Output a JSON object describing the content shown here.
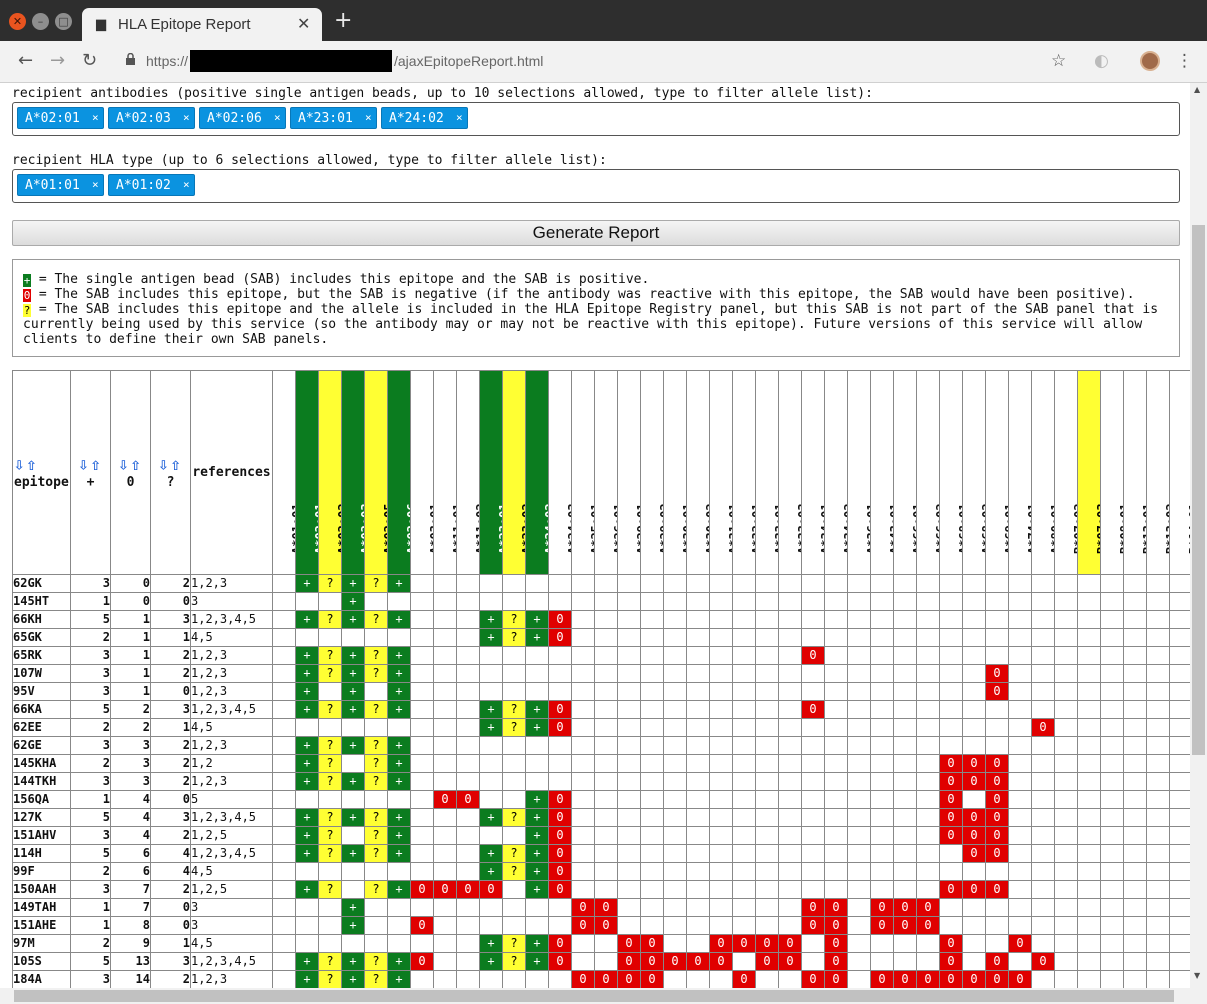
{
  "browser": {
    "tab_title": "HLA Epitope Report",
    "url_prefix": "https://",
    "url_suffix": "/ajaxEpitopeReport.html",
    "new_tab": "+"
  },
  "form": {
    "antibodies_label": "recipient antibodies (positive single antigen beads, up to 10 selections allowed, type to filter allele list):",
    "antibodies": [
      "A*02:01",
      "A*02:03",
      "A*02:06",
      "A*23:01",
      "A*24:02"
    ],
    "hla_label": "recipient HLA type (up to 6 selections allowed, type to filter allele list):",
    "hla_types": [
      "A*01:01",
      "A*01:02"
    ],
    "chip_remove": "×",
    "generate_button": "Generate Report"
  },
  "legend": {
    "plus_symbol": "+",
    "zero_symbol": "0",
    "question_symbol": "?",
    "plus_text": " = The single antigen bead (SAB) includes this epitope and the SAB is positive.",
    "zero_text": " = The SAB includes this epitope, but the SAB is negative (if the antibody was reactive with this epitope, the SAB would have been positive).",
    "question_text": " = The SAB includes this epitope and the allele is included in the HLA Epitope Registry panel, but this SAB is not part of the SAB panel that is",
    "question_text_cont": "currently being used by this service (so the antibody may or may not be reactive with this epitope). Future versions of this service will allow",
    "question_text_cont2": "clients to define their own SAB panels."
  },
  "table": {
    "sort_arrows": "⇩⇧",
    "headers": {
      "epitope": "epitope",
      "plus": "+",
      "zero": "0",
      "question": "?",
      "references": "references"
    },
    "alleles": [
      "A*01:01",
      "A*02:01",
      "A*02:02",
      "A*02:03",
      "A*02:05",
      "A*02:06",
      "A*03:01",
      "A*11:01",
      "A*11:02",
      "A*23:01",
      "A*23:02",
      "A*24:02",
      "A*24:03",
      "A*25:01",
      "A*26:01",
      "A*29:01",
      "A*29:02",
      "A*30:01",
      "A*30:02",
      "A*31:01",
      "A*32:01",
      "A*33:01",
      "A*33:03",
      "A*34:01",
      "A*34:02",
      "A*36:01",
      "A*43:01",
      "A*66:01",
      "A*66:02",
      "A*68:01",
      "A*68:02",
      "A*69:01",
      "A*74:01",
      "A*80:01",
      "B*07:02",
      "B*07:03",
      "B*08:01",
      "B*13:01",
      "B*13:02",
      "B*14:01"
    ],
    "header_colors": [
      "",
      "g",
      "y",
      "g",
      "y",
      "g",
      "",
      "",
      "",
      "g",
      "y",
      "g",
      "",
      "",
      "",
      "",
      "",
      "",
      "",
      "",
      "",
      "",
      "",
      "",
      "",
      "",
      "",
      "",
      "",
      "",
      "",
      "",
      "",
      "",
      "",
      "y",
      "",
      "",
      "",
      ""
    ],
    "rows": [
      {
        "epitope": "62GK",
        "plus": "3",
        "zero": "0",
        "q": "2",
        "refs": "1,2,3",
        "cells": {
          "1": "+",
          "2": "?",
          "3": "+",
          "4": "?",
          "5": "+"
        }
      },
      {
        "epitope": "145HT",
        "plus": "1",
        "zero": "0",
        "q": "0",
        "refs": "3",
        "cells": {
          "3": "+"
        }
      },
      {
        "epitope": "66KH",
        "plus": "5",
        "zero": "1",
        "q": "3",
        "refs": "1,2,3,4,5",
        "cells": {
          "1": "+",
          "2": "?",
          "3": "+",
          "4": "?",
          "5": "+",
          "9": "+",
          "10": "?",
          "11": "+",
          "12": "0"
        }
      },
      {
        "epitope": "65GK",
        "plus": "2",
        "zero": "1",
        "q": "1",
        "refs": "4,5",
        "cells": {
          "9": "+",
          "10": "?",
          "11": "+",
          "12": "0"
        }
      },
      {
        "epitope": "65RK",
        "plus": "3",
        "zero": "1",
        "q": "2",
        "refs": "1,2,3",
        "cells": {
          "1": "+",
          "2": "?",
          "3": "+",
          "4": "?",
          "5": "+",
          "23": "0"
        }
      },
      {
        "epitope": "107W",
        "plus": "3",
        "zero": "1",
        "q": "2",
        "refs": "1,2,3",
        "cells": {
          "1": "+",
          "2": "?",
          "3": "+",
          "4": "?",
          "5": "+",
          "31": "0"
        }
      },
      {
        "epitope": "95V",
        "plus": "3",
        "zero": "1",
        "q": "0",
        "refs": "1,2,3",
        "cells": {
          "1": "+",
          "3": "+",
          "5": "+",
          "31": "0"
        }
      },
      {
        "epitope": "66KA",
        "plus": "5",
        "zero": "2",
        "q": "3",
        "refs": "1,2,3,4,5",
        "cells": {
          "1": "+",
          "2": "?",
          "3": "+",
          "4": "?",
          "5": "+",
          "9": "+",
          "10": "?",
          "11": "+",
          "12": "0",
          "23": "0"
        }
      },
      {
        "epitope": "62EE",
        "plus": "2",
        "zero": "2",
        "q": "1",
        "refs": "4,5",
        "cells": {
          "9": "+",
          "10": "?",
          "11": "+",
          "12": "0",
          "33": "0"
        }
      },
      {
        "epitope": "62GE",
        "plus": "3",
        "zero": "3",
        "q": "2",
        "refs": "1,2,3",
        "cells": {
          "1": "+",
          "2": "?",
          "3": "+",
          "4": "?",
          "5": "+"
        }
      },
      {
        "epitope": "145KHA",
        "plus": "2",
        "zero": "3",
        "q": "2",
        "refs": "1,2",
        "cells": {
          "1": "+",
          "2": "?",
          "4": "?",
          "5": "+",
          "29": "0",
          "30": "0",
          "31": "0"
        }
      },
      {
        "epitope": "144TKH",
        "plus": "3",
        "zero": "3",
        "q": "2",
        "refs": "1,2,3",
        "cells": {
          "1": "+",
          "2": "?",
          "3": "+",
          "4": "?",
          "5": "+",
          "29": "0",
          "30": "0",
          "31": "0"
        }
      },
      {
        "epitope": "156QA",
        "plus": "1",
        "zero": "4",
        "q": "0",
        "refs": "5",
        "cells": {
          "7": "0",
          "8": "0",
          "11": "+",
          "12": "0",
          "29": "0",
          "31": "0"
        }
      },
      {
        "epitope": "127K",
        "plus": "5",
        "zero": "4",
        "q": "3",
        "refs": "1,2,3,4,5",
        "cells": {
          "1": "+",
          "2": "?",
          "3": "+",
          "4": "?",
          "5": "+",
          "9": "+",
          "10": "?",
          "11": "+",
          "12": "0",
          "29": "0",
          "30": "0",
          "31": "0"
        }
      },
      {
        "epitope": "151AHV",
        "plus": "3",
        "zero": "4",
        "q": "2",
        "refs": "1,2,5",
        "cells": {
          "1": "+",
          "2": "?",
          "4": "?",
          "5": "+",
          "11": "+",
          "12": "0",
          "29": "0",
          "30": "0",
          "31": "0"
        }
      },
      {
        "epitope": "114H",
        "plus": "5",
        "zero": "6",
        "q": "4",
        "refs": "1,2,3,4,5",
        "cells": {
          "1": "+",
          "2": "?",
          "3": "+",
          "4": "?",
          "5": "+",
          "9": "+",
          "10": "?",
          "11": "+",
          "12": "0",
          "30": "0",
          "31": "0"
        }
      },
      {
        "epitope": "99F",
        "plus": "2",
        "zero": "6",
        "q": "4",
        "refs": "4,5",
        "cells": {
          "9": "+",
          "10": "?",
          "11": "+",
          "12": "0"
        }
      },
      {
        "epitope": "150AAH",
        "plus": "3",
        "zero": "7",
        "q": "2",
        "refs": "1,2,5",
        "cells": {
          "1": "+",
          "2": "?",
          "4": "?",
          "5": "+",
          "6": "0",
          "7": "0",
          "8": "0",
          "9": "0",
          "11": "+",
          "12": "0",
          "29": "0",
          "30": "0",
          "31": "0"
        }
      },
      {
        "epitope": "149TAH",
        "plus": "1",
        "zero": "7",
        "q": "0",
        "refs": "3",
        "cells": {
          "3": "+",
          "13": "0",
          "14": "0",
          "23": "0",
          "24": "0",
          "26": "0",
          "27": "0",
          "28": "0"
        }
      },
      {
        "epitope": "151AHE",
        "plus": "1",
        "zero": "8",
        "q": "0",
        "refs": "3",
        "cells": {
          "3": "+",
          "6": "0",
          "13": "0",
          "14": "0",
          "23": "0",
          "24": "0",
          "26": "0",
          "27": "0",
          "28": "0"
        }
      },
      {
        "epitope": "97M",
        "plus": "2",
        "zero": "9",
        "q": "1",
        "refs": "4,5",
        "cells": {
          "9": "+",
          "10": "?",
          "11": "+",
          "12": "0",
          "15": "0",
          "16": "0",
          "19": "0",
          "20": "0",
          "21": "0",
          "22": "0",
          "24": "0",
          "29": "0",
          "32": "0"
        }
      },
      {
        "epitope": "105S",
        "plus": "5",
        "zero": "13",
        "q": "3",
        "refs": "1,2,3,4,5",
        "cells": {
          "1": "+",
          "2": "?",
          "3": "+",
          "4": "?",
          "5": "+",
          "6": "0",
          "9": "+",
          "10": "?",
          "11": "+",
          "12": "0",
          "15": "0",
          "16": "0",
          "17": "0",
          "18": "0",
          "19": "0",
          "21": "0",
          "22": "0",
          "24": "0",
          "29": "0",
          "31": "0",
          "33": "0"
        }
      },
      {
        "epitope": "184A",
        "plus": "3",
        "zero": "14",
        "q": "2",
        "refs": "1,2,3",
        "cells": {
          "1": "+",
          "2": "?",
          "3": "+",
          "4": "?",
          "5": "+",
          "13": "0",
          "14": "0",
          "15": "0",
          "16": "0",
          "20": "0",
          "23": "0",
          "24": "0",
          "26": "0",
          "27": "0",
          "28": "0",
          "29": "0",
          "30": "0",
          "31": "0",
          "32": "0"
        }
      }
    ]
  }
}
